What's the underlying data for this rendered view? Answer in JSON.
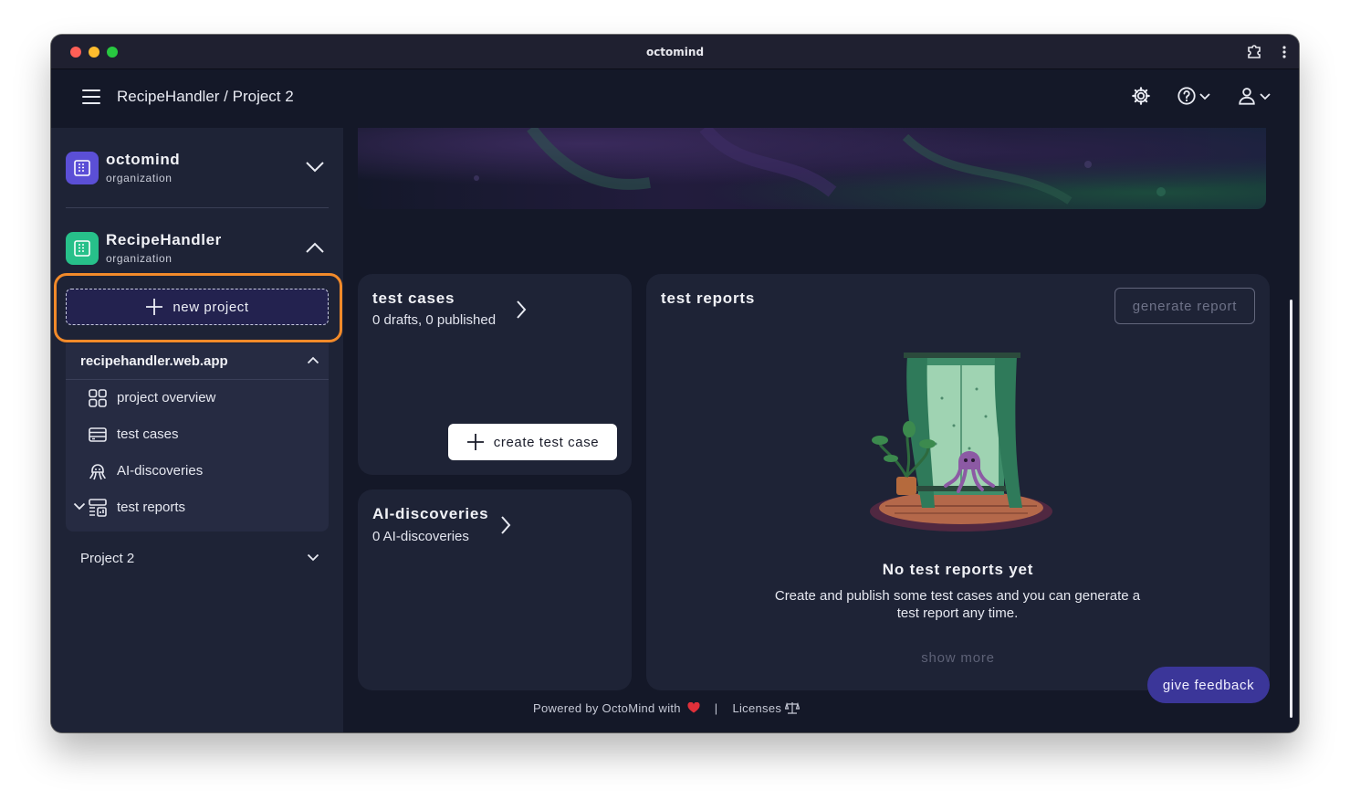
{
  "window": {
    "title": "octomind"
  },
  "appbar": {
    "breadcrumb": "RecipeHandler / Project 2"
  },
  "sidebar": {
    "org1": {
      "name": "octomind",
      "sub": "organization"
    },
    "org2": {
      "name": "RecipeHandler",
      "sub": "organization"
    },
    "new_project_label": "new project",
    "project": {
      "name": "recipehandler.web.app",
      "items": [
        {
          "label": "project overview",
          "icon": "grid-icon"
        },
        {
          "label": "test cases",
          "icon": "test-cases-icon"
        },
        {
          "label": "AI-discoveries",
          "icon": "octopus-icon"
        },
        {
          "label": "test reports",
          "icon": "report-icon"
        }
      ]
    },
    "other_project": "Project 2"
  },
  "cards": {
    "test_cases": {
      "title": "test cases",
      "sub": "0 drafts, 0 published",
      "button": "create test case"
    },
    "ai_discoveries": {
      "title": "AI-discoveries",
      "sub": "0 AI-discoveries"
    },
    "test_reports": {
      "title": "test reports",
      "button": "generate report",
      "empty_title": "No test reports yet",
      "empty_desc": "Create and publish some test cases and you can generate a test report any time.",
      "show_more": "show more"
    }
  },
  "footer": {
    "powered": "Powered by OctoMind with",
    "sep": "|",
    "licenses": "Licenses"
  },
  "feedback_label": "give feedback",
  "colors": {
    "accent": "#3b3699",
    "highlight": "#f28a2a",
    "org1_logo": "#5b4fd6",
    "org2_logo": "#27c08a"
  }
}
